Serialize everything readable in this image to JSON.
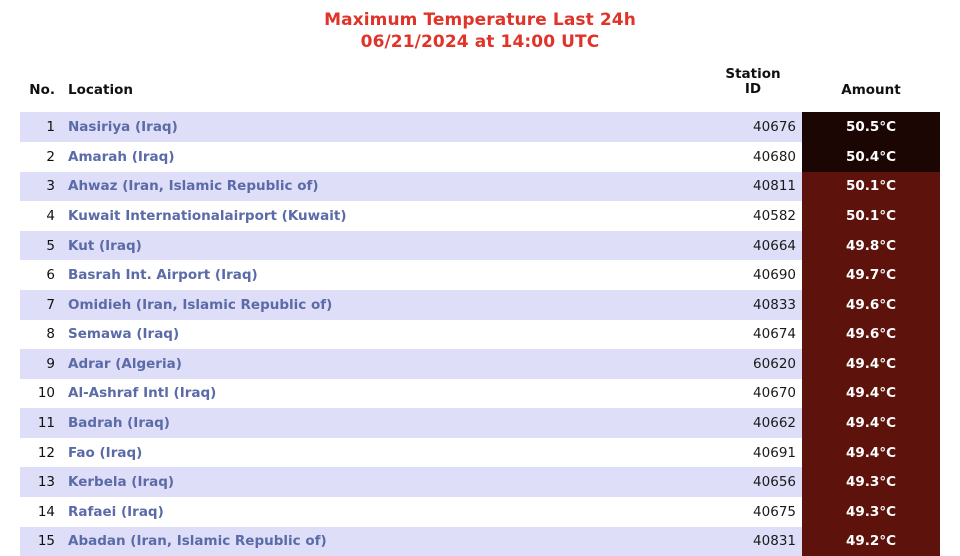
{
  "title": {
    "line1": "Maximum Temperature Last 24h",
    "line2": "06/21/2024 at 14:00 UTC",
    "color": "#e0332a"
  },
  "columns": {
    "no": "No.",
    "location": "Location",
    "station_id_line1": "Station",
    "station_id_line2": "ID",
    "amount": "Amount"
  },
  "colors": {
    "row_stripe": "#dedef8",
    "row_plain": "#ffffff",
    "amount_hot": "#1c0604",
    "amount_warm": "#5d120b",
    "location_link": "#5b6ba8",
    "title_red": "#e0332a"
  },
  "rows": [
    {
      "no": "1",
      "location": "Nasiriya (Iraq)",
      "station_id": "40676",
      "amount": "50.5°C",
      "heat": "heat-hot"
    },
    {
      "no": "2",
      "location": "Amarah (Iraq)",
      "station_id": "40680",
      "amount": "50.4°C",
      "heat": "heat-hot"
    },
    {
      "no": "3",
      "location": "Ahwaz (Iran, Islamic Republic of)",
      "station_id": "40811",
      "amount": "50.1°C",
      "heat": "heat-warm"
    },
    {
      "no": "4",
      "location": "Kuwait Internationalairport (Kuwait)",
      "station_id": "40582",
      "amount": "50.1°C",
      "heat": "heat-warm"
    },
    {
      "no": "5",
      "location": "Kut (Iraq)",
      "station_id": "40664",
      "amount": "49.8°C",
      "heat": "heat-warm"
    },
    {
      "no": "6",
      "location": "Basrah Int. Airport (Iraq)",
      "station_id": "40690",
      "amount": "49.7°C",
      "heat": "heat-warm"
    },
    {
      "no": "7",
      "location": "Omidieh (Iran, Islamic Republic of)",
      "station_id": "40833",
      "amount": "49.6°C",
      "heat": "heat-warm"
    },
    {
      "no": "8",
      "location": "Semawa (Iraq)",
      "station_id": "40674",
      "amount": "49.6°C",
      "heat": "heat-warm"
    },
    {
      "no": "9",
      "location": "Adrar (Algeria)",
      "station_id": "60620",
      "amount": "49.4°C",
      "heat": "heat-warm"
    },
    {
      "no": "10",
      "location": "Al-Ashraf Intl (Iraq)",
      "station_id": "40670",
      "amount": "49.4°C",
      "heat": "heat-warm"
    },
    {
      "no": "11",
      "location": "Badrah (Iraq)",
      "station_id": "40662",
      "amount": "49.4°C",
      "heat": "heat-warm"
    },
    {
      "no": "12",
      "location": "Fao (Iraq)",
      "station_id": "40691",
      "amount": "49.4°C",
      "heat": "heat-warm"
    },
    {
      "no": "13",
      "location": "Kerbela (Iraq)",
      "station_id": "40656",
      "amount": "49.3°C",
      "heat": "heat-warm"
    },
    {
      "no": "14",
      "location": "Rafaei (Iraq)",
      "station_id": "40675",
      "amount": "49.3°C",
      "heat": "heat-warm"
    },
    {
      "no": "15",
      "location": "Abadan (Iran, Islamic Republic of)",
      "station_id": "40831",
      "amount": "49.2°C",
      "heat": "heat-warm"
    }
  ]
}
